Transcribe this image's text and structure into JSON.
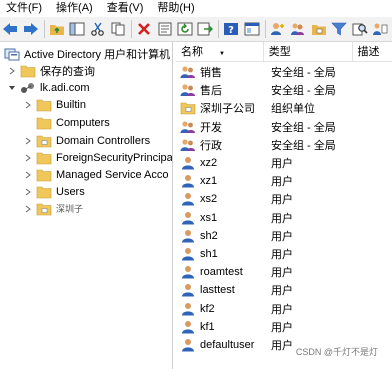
{
  "menu": [
    "文件(F)",
    "操作(A)",
    "查看(V)",
    "帮助(H)"
  ],
  "toolbar_icons": [
    "back-icon",
    "forward-icon",
    "up-folder-icon",
    "show-tree-icon",
    "cut-icon",
    "copy-icon",
    "delete-icon",
    "properties-icon",
    "refresh-icon",
    "export-icon",
    "help-icon",
    "console-icon",
    "new-user-icon",
    "new-group-icon",
    "new-ou-icon",
    "filter-icon",
    "find-icon",
    "add-to-group-icon"
  ],
  "tree": {
    "root": "Active Directory 用户和计算机",
    "saved_queries": "保存的查询",
    "domain": "lk.adi.com",
    "children": [
      "Builtin",
      "Computers",
      "Domain Controllers",
      "ForeignSecurityPrincipa",
      "Managed Service Acco",
      "Users",
      "深圳子"
    ]
  },
  "columns": {
    "name": "名称",
    "type": "类型",
    "desc": "描述"
  },
  "rows": [
    {
      "name": "销售",
      "type": "安全组 - 全局",
      "icon": "group"
    },
    {
      "name": "售后",
      "type": "安全组 - 全局",
      "icon": "group"
    },
    {
      "name": "深圳子公司",
      "type": "组织单位",
      "icon": "ou"
    },
    {
      "name": "开发",
      "type": "安全组 - 全局",
      "icon": "group"
    },
    {
      "name": "行政",
      "type": "安全组 - 全局",
      "icon": "group"
    },
    {
      "name": "xz2",
      "type": "用户",
      "icon": "user"
    },
    {
      "name": "xz1",
      "type": "用户",
      "icon": "user"
    },
    {
      "name": "xs2",
      "type": "用户",
      "icon": "user"
    },
    {
      "name": "xs1",
      "type": "用户",
      "icon": "user"
    },
    {
      "name": "sh2",
      "type": "用户",
      "icon": "user"
    },
    {
      "name": "sh1",
      "type": "用户",
      "icon": "user"
    },
    {
      "name": "roamtest",
      "type": "用户",
      "icon": "user"
    },
    {
      "name": "lasttest",
      "type": "用户",
      "icon": "user"
    },
    {
      "name": "kf2",
      "type": "用户",
      "icon": "user"
    },
    {
      "name": "kf1",
      "type": "用户",
      "icon": "user"
    },
    {
      "name": "defaultuser",
      "type": "用户",
      "icon": "user"
    }
  ],
  "watermark": "CSDN @千灯不是灯"
}
